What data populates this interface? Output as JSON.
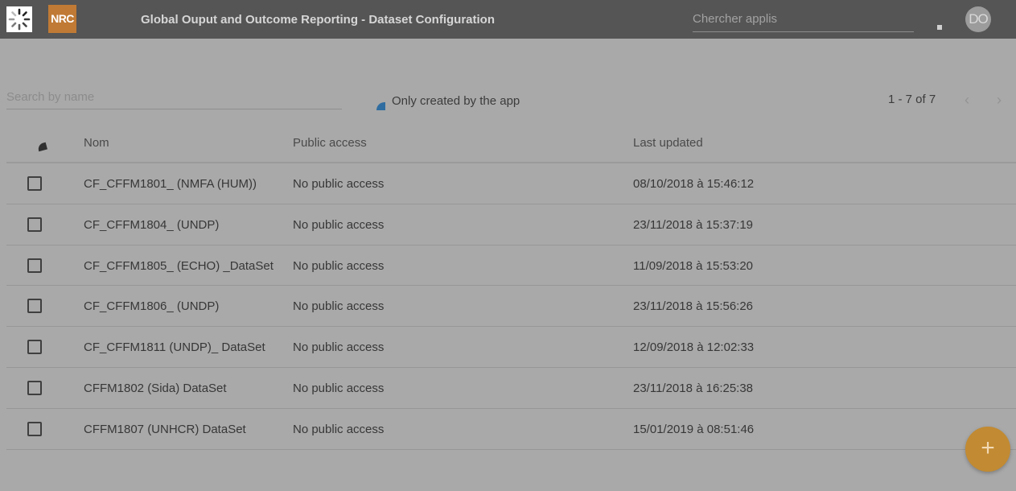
{
  "header": {
    "logo_text": "NRC",
    "title": "Global Ouput and Outcome Reporting - Dataset Configuration",
    "search_placeholder": "Chercher applis",
    "avatar_initials": "DO"
  },
  "toolbar": {
    "search_placeholder": "Search by name",
    "toggle_label": "Only created by the app",
    "pagination": "1 - 7 of 7"
  },
  "table": {
    "columns": [
      "Nom",
      "Public access",
      "Last updated"
    ],
    "rows": [
      {
        "name": "CF_CFFM1801_ (NMFA (HUM))",
        "public_access": "No public access",
        "last_updated": "08/10/2018 à 15:46:12"
      },
      {
        "name": "CF_CFFM1804_ (UNDP)",
        "public_access": "No public access",
        "last_updated": "23/11/2018 à 15:37:19"
      },
      {
        "name": "CF_CFFM1805_ (ECHO) _DataSet",
        "public_access": "No public access",
        "last_updated": "11/09/2018 à 15:53:20"
      },
      {
        "name": "CF_CFFM1806_ (UNDP)",
        "public_access": "No public access",
        "last_updated": "23/11/2018 à 15:56:26"
      },
      {
        "name": "CF_CFFM1811 (UNDP)_ DataSet",
        "public_access": "No public access",
        "last_updated": "12/09/2018 à 12:02:33"
      },
      {
        "name": "CFFM1802 (Sida) DataSet",
        "public_access": "No public access",
        "last_updated": "23/11/2018 à 16:25:38"
      },
      {
        "name": "CFFM1807 (UNHCR) DataSet",
        "public_access": "No public access",
        "last_updated": "15/01/2019 à 08:51:46"
      }
    ]
  },
  "fab_label": "+",
  "icons": {
    "spinner": "loading-spinner-icon",
    "apps": "apps-icon",
    "pager_prev": "chevron-left-icon",
    "pager_next": "chevron-right-icon",
    "sort": "sort-icon",
    "toggle": "toggle-icon",
    "add": "add-icon"
  },
  "colors": {
    "header_bg": "#555555",
    "page_bg": "#a9a9a9",
    "brand_orange": "#c07a35",
    "fab": "#c28a32",
    "toggle_blue": "#2f6da0"
  }
}
